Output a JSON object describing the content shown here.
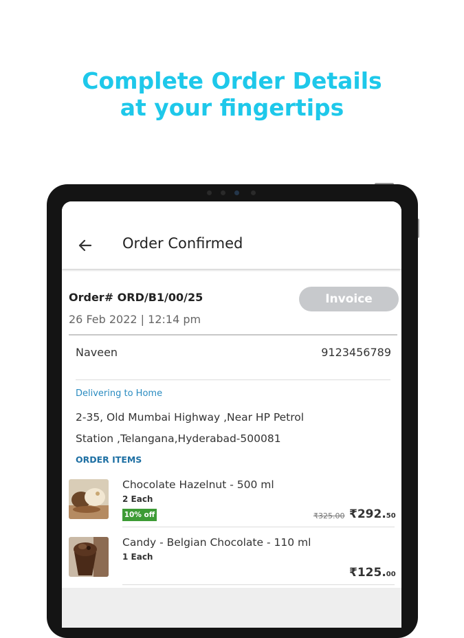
{
  "promo": {
    "headline_line1": "Complete Order Details",
    "headline_line2": "at your fingertips",
    "accent_color": "#1ec8ea"
  },
  "appbar": {
    "back_icon": "arrow-left-icon",
    "title": "Order Confirmed"
  },
  "order": {
    "number": "Order# ORD/B1/00/25",
    "date": "26 Feb 2022 | 12:14 pm",
    "invoice_label": "Invoice"
  },
  "customer": {
    "name": "Naveen",
    "phone": "9123456789"
  },
  "delivery": {
    "label": "Delivering to Home",
    "address_line1": "2-35, Old Mumbai Highway ,Near HP Petrol",
    "address_line2": "Station ,Telangana,Hyderabad-500081"
  },
  "items_section": {
    "label": "ORDER ITEMS",
    "items": [
      {
        "name": "Chocolate Hazelnut - 500 ml",
        "qty": "2 Each",
        "offer": "10% off",
        "original_price": "₹325.00",
        "price_main": "₹292.",
        "price_cents": "50"
      },
      {
        "name": "Candy - Belgian Chocolate - 110 ml",
        "qty": "1 Each",
        "price_main": "₹125.",
        "price_cents": "00"
      }
    ]
  }
}
